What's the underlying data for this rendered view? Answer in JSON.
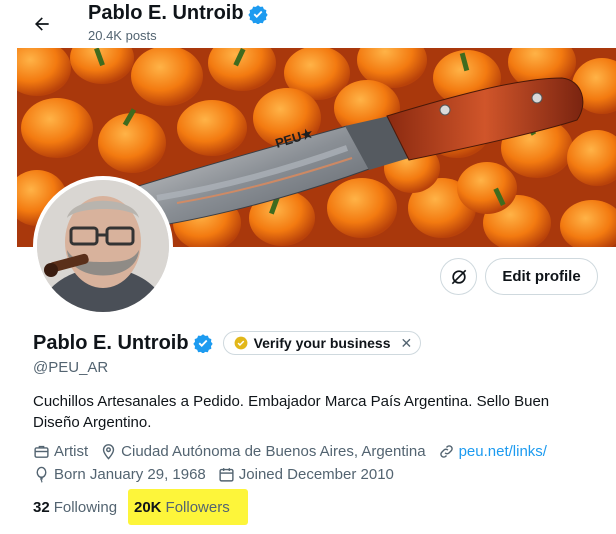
{
  "header": {
    "name": "Pablo E. Untroib",
    "posts": "20.4K posts"
  },
  "profile": {
    "display_name": "Pablo E. Untroib",
    "handle": "@PEU_AR",
    "verify_business": "Verify your business",
    "bio": "Cuchillos Artesanales a Pedido. Embajador Marca País Argentina. Sello Buen Diseño Argentino.",
    "edit_profile": "Edit profile",
    "category": "Artist",
    "location": "Ciudad Autónoma de Buenos Aires, Argentina",
    "website": "peu.net/links/",
    "born": "Born January 29, 1968",
    "joined": "Joined December 2010",
    "following_count": "32",
    "following_label": "Following",
    "followers_count": "20K",
    "followers_label": "Followers"
  },
  "banner": {
    "knife_mark": "PEU★"
  },
  "colors": {
    "accent": "#1d9bf0",
    "text": "#0f1419",
    "muted": "#536471",
    "highlight": "#fdf53a",
    "gold_badge": "#e2b719"
  },
  "icons": [
    "back-arrow-icon",
    "verified-badge-icon",
    "gold-check-icon",
    "close-icon",
    "no-sync-icon",
    "briefcase-icon",
    "location-pin-icon",
    "link-icon",
    "balloon-icon",
    "calendar-icon"
  ]
}
